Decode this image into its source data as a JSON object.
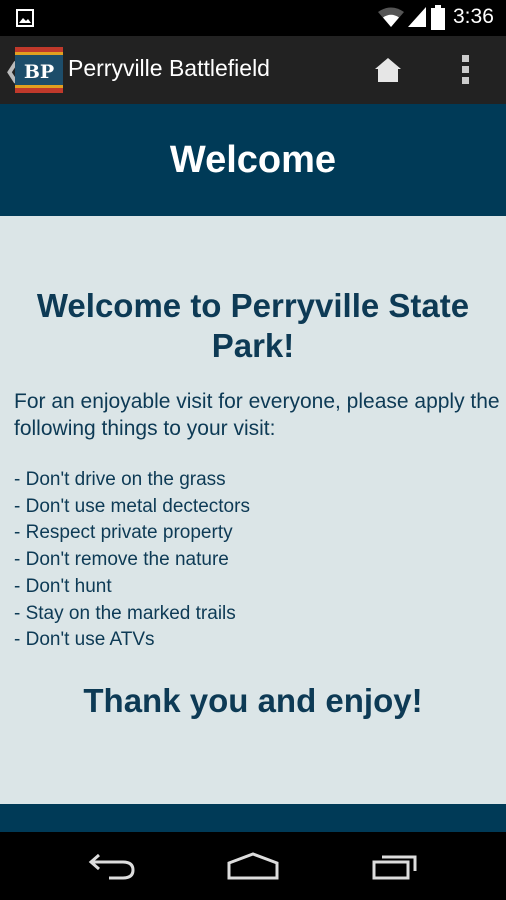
{
  "status_bar": {
    "time": "3:36",
    "icons": [
      "image-notification-icon",
      "wifi-icon",
      "signal-icon",
      "battery-icon"
    ]
  },
  "action_bar": {
    "logo_text": "BP",
    "title": "Perryville Battlefield",
    "icons": [
      "chevron-left-icon",
      "home-icon",
      "overflow-menu-icon"
    ]
  },
  "header": {
    "title": "Welcome"
  },
  "content": {
    "park_title": "Welcome to Perryville State Park!",
    "intro": "For an enjoyable visit for everyone, please apply the following things to your visit:",
    "rules": [
      "- Don't drive on the grass",
      "- Don't use metal dectectors",
      "- Respect private property",
      "- Don't remove the nature",
      "- Don't hunt",
      "- Stay on the marked trails",
      "- Don't use ATVs"
    ],
    "closing": "Thank you and enjoy!"
  },
  "nav_bar": {
    "icons": [
      "back-icon",
      "home-outline-icon",
      "recents-icon"
    ]
  },
  "colors": {
    "header_bg": "#003a57",
    "content_bg": "#dbe5e7",
    "text": "#0d3a55",
    "action_bar_bg": "#222222"
  }
}
